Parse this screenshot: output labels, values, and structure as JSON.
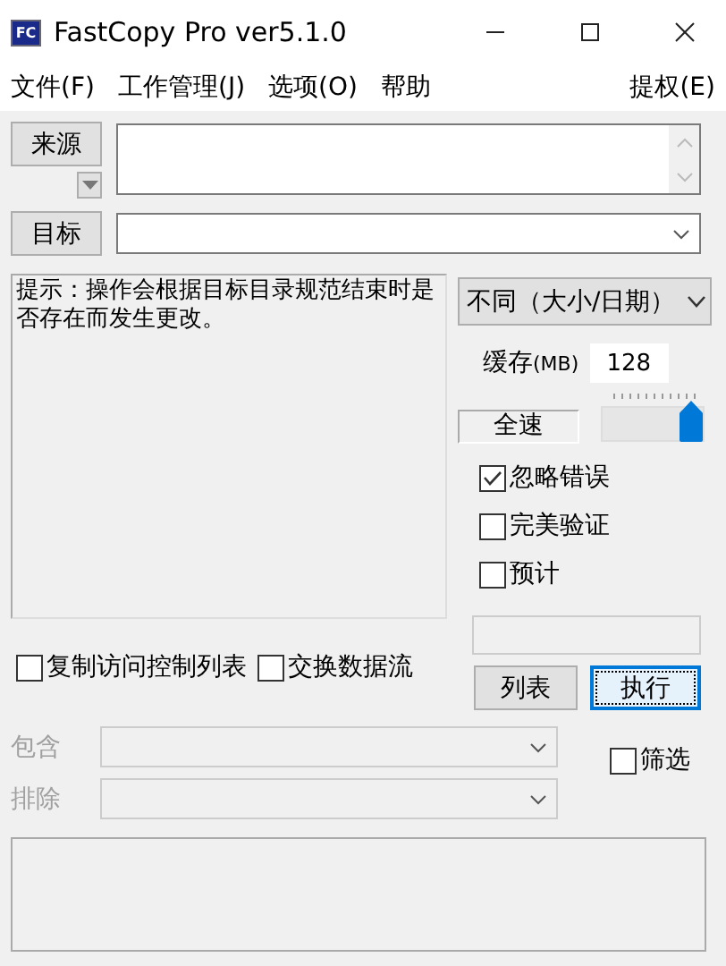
{
  "window": {
    "title": "FastCopy Pro ver5.1.0",
    "app_icon_text": "FC"
  },
  "menu": [
    {
      "label": "文件(F)"
    },
    {
      "label": "工作管理(J)"
    },
    {
      "label": "选项(O)"
    },
    {
      "label": "帮助"
    }
  ],
  "menu_right": {
    "label": "提权(E)"
  },
  "source": {
    "button": "来源"
  },
  "target": {
    "button": "目标"
  },
  "hint": "提示：操作会根据目标目录规范结束时是否存在而发生更改。",
  "mode": {
    "value": "不同（大小/日期）"
  },
  "buffer": {
    "label": "缓存",
    "unit": "(MB)",
    "value": "128"
  },
  "speed": {
    "label": "全速",
    "level": 1.0
  },
  "options": [
    {
      "label": "忽略错误",
      "checked": true
    },
    {
      "label": "完美验证",
      "checked": false
    },
    {
      "label": "预计",
      "checked": false
    }
  ],
  "extra_options": [
    {
      "label": "复制访问控制列表",
      "checked": false
    },
    {
      "label": "交换数据流",
      "checked": false
    }
  ],
  "buttons": [
    {
      "label": "列表",
      "focused": false
    },
    {
      "label": "执行",
      "focused": true
    }
  ],
  "filters": [
    {
      "label": "包含",
      "disabled": true
    },
    {
      "label": "排除",
      "disabled": true
    }
  ],
  "filter_toggle": {
    "label": "筛选",
    "checked": false
  }
}
